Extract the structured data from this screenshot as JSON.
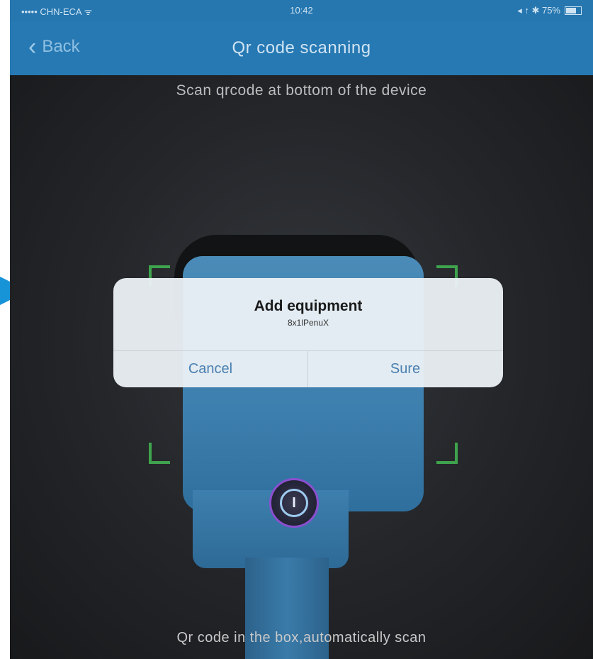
{
  "status_bar": {
    "carrier": "••••• CHN-ECA ᯤ",
    "time": "10:42",
    "battery": "◂ ↑ ✱ 75%"
  },
  "nav": {
    "back_label": "Back",
    "title": "Qr code scanning"
  },
  "camera": {
    "hint_top": "Scan qrcode at bottom of the device",
    "hint_bottom": "Qr code in the box,automatically scan"
  },
  "dialog": {
    "title": "Add equipment",
    "message": "8x1lPenuX",
    "cancel_label": "Cancel",
    "sure_label": "Sure"
  },
  "colors": {
    "nav_blue": "#2779b3",
    "scan_frame": "#3fa34d",
    "dialog_button": "#4a7fb0",
    "arrow": "#1793d8"
  }
}
